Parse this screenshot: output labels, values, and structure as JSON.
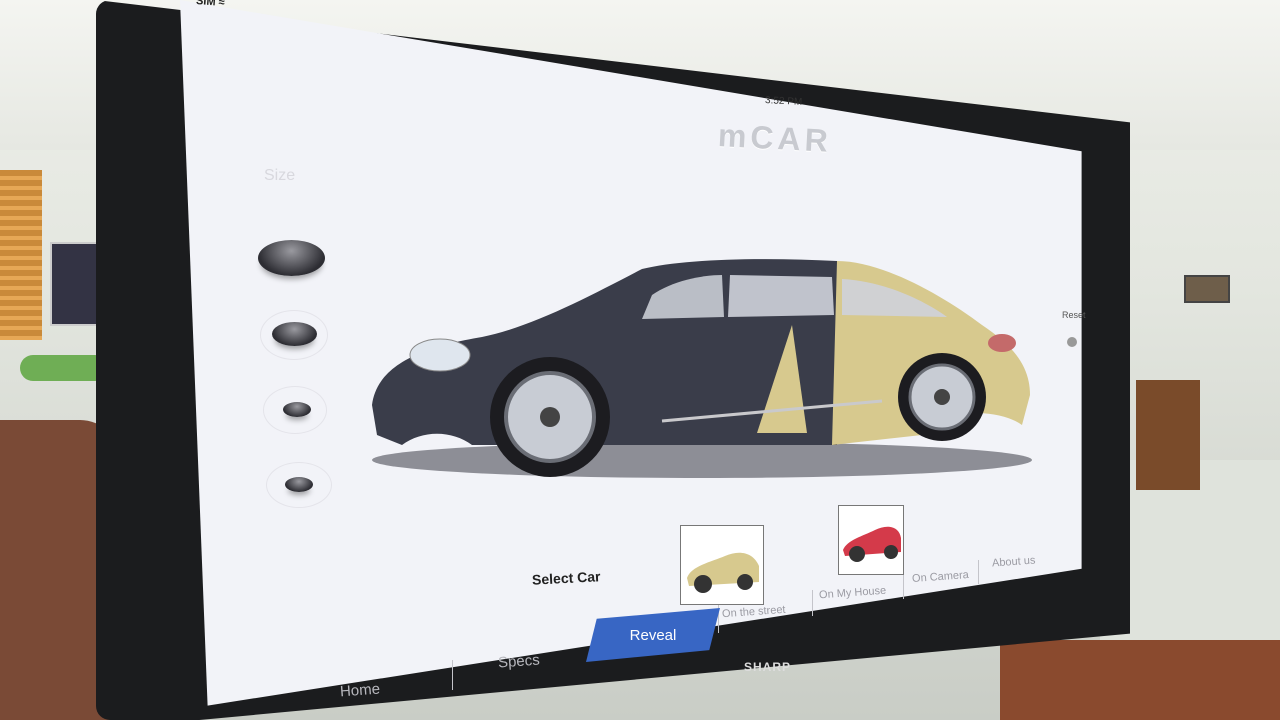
{
  "status_bar": {
    "carrier": "SIM",
    "time": "3:52 PM"
  },
  "app": {
    "title": "mCAR"
  },
  "size_panel": {
    "label": "Size"
  },
  "reset": {
    "label": "Reset"
  },
  "select_car": {
    "label": "Select Car"
  },
  "sub_tabs": [
    "On the street",
    "On My House",
    "On Camera",
    "About us"
  ],
  "nav_tabs": {
    "home": "Home",
    "specs": "Specs",
    "reveal": "Reveal"
  },
  "monitor_brand": "SHARP",
  "colors": {
    "accent": "#3866c4",
    "car_dark": "#3a3d4a",
    "car_gold": "#d7c98e",
    "thumb_red": "#d43a4a"
  }
}
